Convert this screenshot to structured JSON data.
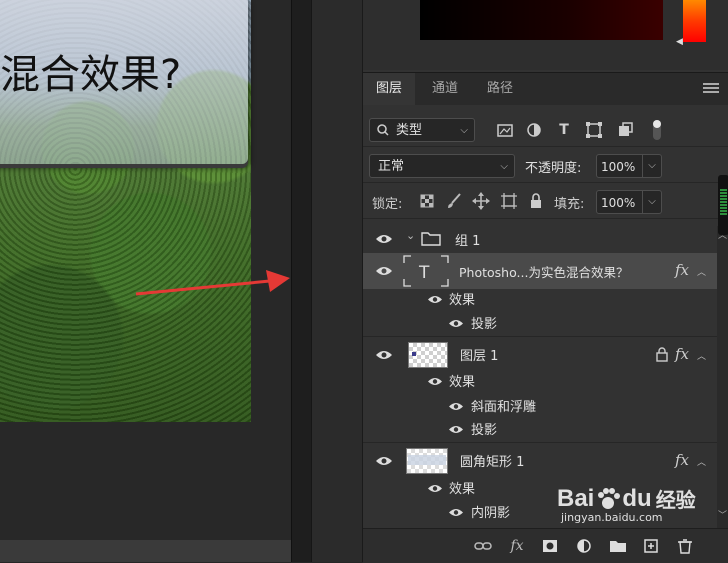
{
  "canvas": {
    "title_text": "混合效果?"
  },
  "panel": {
    "tabs": [
      {
        "label": "图层",
        "active": true
      },
      {
        "label": "通道",
        "active": false
      },
      {
        "label": "路径",
        "active": false
      }
    ],
    "filter": {
      "kind_label": "类型"
    },
    "blend_mode": "正常",
    "opacity": {
      "label": "不透明度:",
      "value": "100%"
    },
    "lock": {
      "label": "锁定:"
    },
    "fill": {
      "label": "填充:",
      "value": "100%"
    },
    "layers": {
      "group": {
        "name": "组 1"
      },
      "text_layer": {
        "name": "Photosho...为实色混合效果？",
        "effects_label": "效果",
        "effects": [
          "投影"
        ]
      },
      "layer1": {
        "name": "图层 1",
        "effects_label": "效果",
        "effects": [
          "斜面和浮雕",
          "投影"
        ]
      },
      "rounded_rect": {
        "name": "圆角矩形 1",
        "effects_label": "效果",
        "effects": [
          "内阴影"
        ]
      }
    },
    "fx_label": "fx"
  },
  "watermark": {
    "brand": "Bai",
    "brand2": "du",
    "suffix": "经验",
    "url": "jingyan.baidu.com"
  },
  "colors": {
    "accent_red": "#e53935",
    "panel_bg": "#323232",
    "selected_row": "#4a4a4a"
  }
}
